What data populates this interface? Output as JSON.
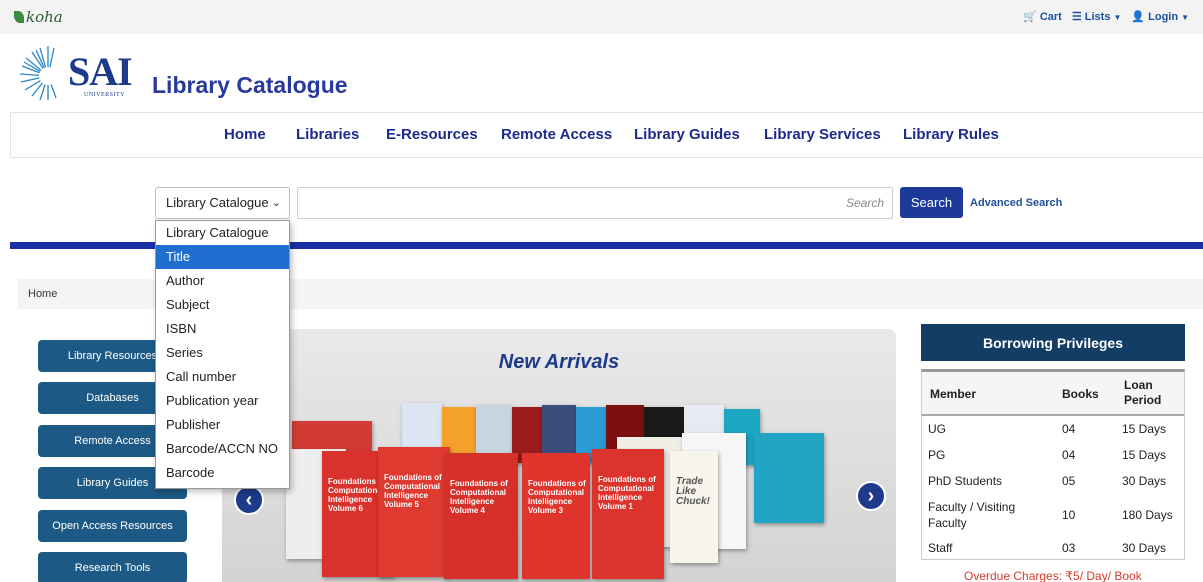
{
  "topbar": {
    "brand": "koha",
    "cart_label": "Cart",
    "lists_label": "Lists",
    "login_label": "Login"
  },
  "header": {
    "logo_main": "SAI",
    "logo_sub": "UNIVERSITY",
    "site_title": "Library Catalogue"
  },
  "nav": {
    "items": [
      "Home",
      "Libraries",
      "E-Resources",
      "Remote Access",
      "Library Guides",
      "Library Services",
      "Library Rules"
    ]
  },
  "search": {
    "selected_index": "Library Catalogue",
    "placeholder": "Search",
    "button_label": "Search",
    "advanced_label": "Advanced Search",
    "options": [
      "Library Catalogue",
      "Title",
      "Author",
      "Subject",
      "ISBN",
      "Series",
      "Call number",
      "Publication year",
      "Publisher",
      "Barcode/ACCN NO",
      "Barcode"
    ],
    "highlighted_option": "Title"
  },
  "breadcrumb": {
    "home": "Home"
  },
  "sidebar": {
    "items": [
      "Library Resources",
      "Databases",
      "Remote Access",
      "Library Guides",
      "Open Access Resources",
      "Research Tools"
    ]
  },
  "carousel": {
    "title": "New Arrivals",
    "prev_icon": "chevron-left-icon",
    "next_icon": "chevron-right-icon",
    "books": [
      {
        "title": "Foundations of Computational Intelligence Volume 6"
      },
      {
        "title": "Foundations of Computational Intelligence Volume 5"
      },
      {
        "title": "Foundations of Computational Intelligence Volume 4"
      },
      {
        "title": "Foundations of Computational Intelligence Volume 3"
      },
      {
        "title": "Foundations of Computational Intelligence Volume 1"
      },
      {
        "title": "Trade Like Chuck!"
      }
    ]
  },
  "privileges": {
    "title": "Borrowing Privileges",
    "columns": [
      "Member",
      "Books",
      "Loan Period"
    ],
    "rows": [
      {
        "member": "UG",
        "books": "04",
        "period": "15 Days"
      },
      {
        "member": "PG",
        "books": "04",
        "period": "15 Days"
      },
      {
        "member": "PhD Students",
        "books": "05",
        "period": "30 Days"
      },
      {
        "member": "Faculty / Visiting Faculty",
        "books": "10",
        "period": "180 Days"
      },
      {
        "member": "Staff",
        "books": "03",
        "period": "30 Days"
      }
    ],
    "overdue": "Overdue Charges: ₹5/ Day/ Book"
  },
  "colors": {
    "primary": "#1d3a9a",
    "nav_text": "#1e2a8c",
    "sidebar_button": "#1c5a85",
    "privileges_header": "#143d66",
    "overdue_text": "#d63b2f",
    "dropdown_highlight": "#1f6fd1"
  }
}
